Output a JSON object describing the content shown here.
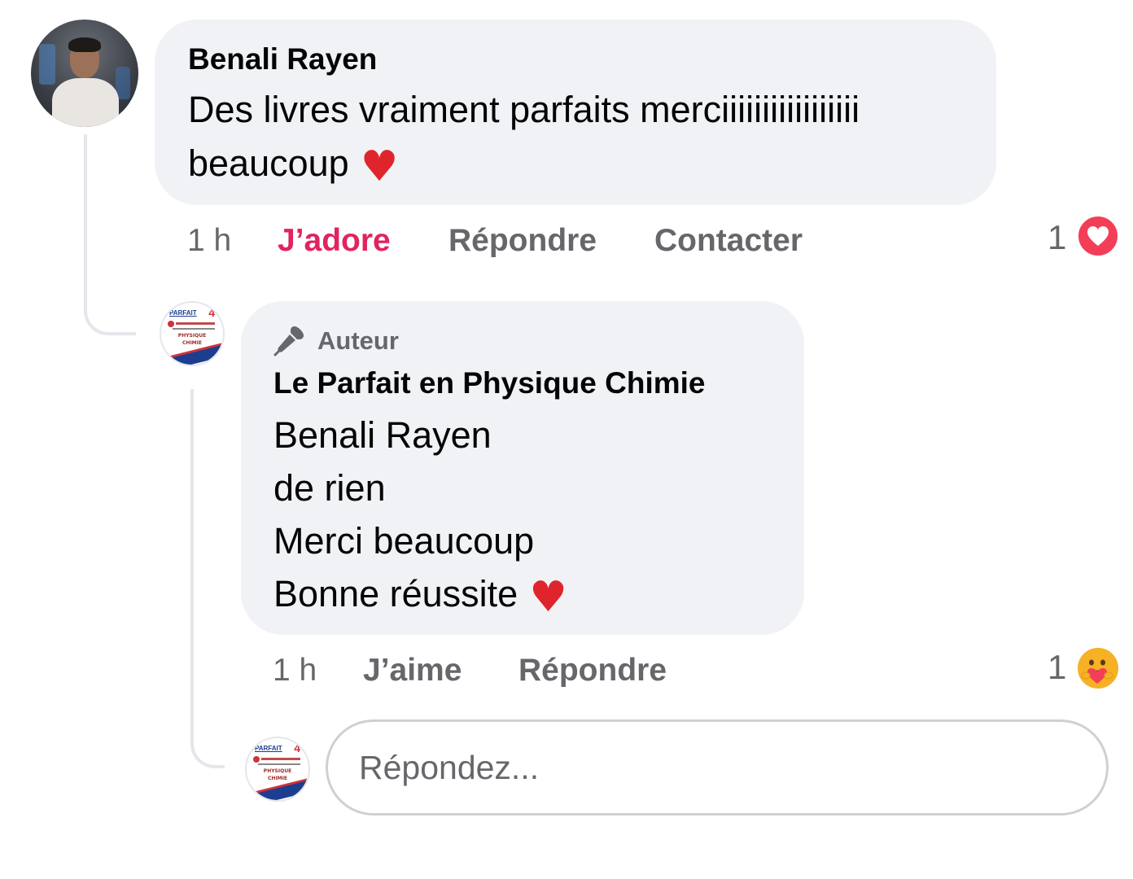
{
  "comment": {
    "author": "Benali Rayen",
    "text_line1": "Des livres vraiment parfaits merciiiiiiiiiiiiiiiii",
    "text_line2": "beaucoup",
    "emoji": "❤️",
    "time": "1 h",
    "actions": {
      "like": "J’adore",
      "reply": "Répondre",
      "contact": "Contacter"
    },
    "reaction_count": "1",
    "reaction_icon": "love-reaction",
    "like_color": "#e0245e"
  },
  "reply": {
    "badge": "Auteur",
    "badge_icon": "microphone-icon",
    "author": "Le Parfait en Physique Chimie",
    "lines": [
      "Benali Rayen",
      "de rien",
      "Merci beaucoup",
      "Bonne réussite"
    ],
    "emoji": "❤️",
    "time": "1 h",
    "actions": {
      "like": "J’aime",
      "reply": "Répondre"
    },
    "reaction_count": "1",
    "reaction_icon": "care-reaction"
  },
  "page_logo": {
    "word": "PARFAIT",
    "number": "4",
    "sub1": "PHYSIQUE",
    "sub2": "CHIMIE"
  },
  "reply_box": {
    "placeholder": "Répondez..."
  },
  "colors": {
    "bubble": "#f0f2f5",
    "secondary_text": "#65676b",
    "love": "#f33e58",
    "care": "#f7b125"
  }
}
